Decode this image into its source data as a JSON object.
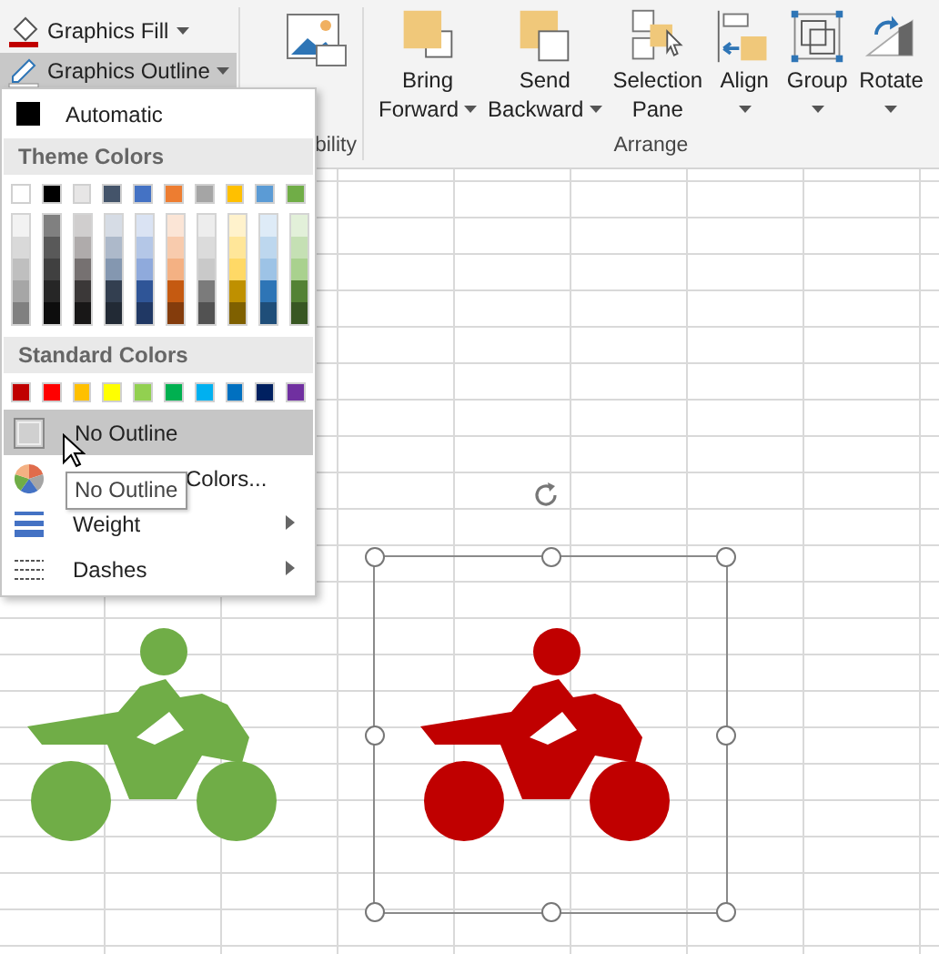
{
  "ribbon": {
    "fill_button": {
      "label": "Graphics Fill",
      "selected": false
    },
    "outline_button": {
      "label": "Graphics Outline",
      "selected": true
    },
    "accessibility_group": "bility",
    "arrange_buttons": [
      {
        "kind": "bring-forward",
        "lines": [
          "Bring",
          "Forward"
        ],
        "dropdown": true
      },
      {
        "kind": "send-backward",
        "lines": [
          "Send",
          "Backward"
        ],
        "dropdown": true
      },
      {
        "kind": "selection-pane",
        "lines": [
          "Selection",
          "Pane"
        ],
        "dropdown": false
      },
      {
        "kind": "align",
        "lines": [
          "Align"
        ],
        "dropdown": true
      },
      {
        "kind": "group",
        "lines": [
          "Group"
        ],
        "dropdown": true
      },
      {
        "kind": "rotate",
        "lines": [
          "Rotate"
        ],
        "dropdown": true
      }
    ],
    "arrange_group": "Arrange"
  },
  "menu": {
    "automatic": {
      "label": "Automatic",
      "color": "#000000"
    },
    "theme_header": "Theme Colors",
    "theme_colors": [
      {
        "color": "#ffffff",
        "shades": [
          {
            "color": "#f2f2f2"
          },
          {
            "color": "#d9d9d9"
          },
          {
            "color": "#bfbfbf"
          },
          {
            "color": "#a6a6a6"
          },
          {
            "color": "#808080"
          }
        ]
      },
      {
        "color": "#000000",
        "shades": [
          {
            "color": "#808080"
          },
          {
            "color": "#595959"
          },
          {
            "color": "#404040"
          },
          {
            "color": "#262626"
          },
          {
            "color": "#0d0d0d"
          }
        ]
      },
      {
        "color": "#e7e6e6",
        "shades": [
          {
            "color": "#d0cece"
          },
          {
            "color": "#afabab"
          },
          {
            "color": "#767171"
          },
          {
            "color": "#3b3838"
          },
          {
            "color": "#181717"
          }
        ]
      },
      {
        "color": "#44546a",
        "shades": [
          {
            "color": "#d6dce5"
          },
          {
            "color": "#adb9ca"
          },
          {
            "color": "#8497b0"
          },
          {
            "color": "#333f50"
          },
          {
            "color": "#222a35"
          }
        ]
      },
      {
        "color": "#4472c4",
        "shades": [
          {
            "color": "#dae3f3"
          },
          {
            "color": "#b4c7e7"
          },
          {
            "color": "#8faadc"
          },
          {
            "color": "#2f5597"
          },
          {
            "color": "#203864"
          }
        ]
      },
      {
        "color": "#ed7d31",
        "shades": [
          {
            "color": "#fbe5d6"
          },
          {
            "color": "#f8cbad"
          },
          {
            "color": "#f4b183"
          },
          {
            "color": "#c55a11"
          },
          {
            "color": "#843c0c"
          }
        ]
      },
      {
        "color": "#a5a5a5",
        "shades": [
          {
            "color": "#ededed"
          },
          {
            "color": "#dbdbdb"
          },
          {
            "color": "#c9c9c9"
          },
          {
            "color": "#7b7b7b"
          },
          {
            "color": "#525252"
          }
        ]
      },
      {
        "color": "#ffc000",
        "shades": [
          {
            "color": "#fff2cc"
          },
          {
            "color": "#ffe699"
          },
          {
            "color": "#ffd966"
          },
          {
            "color": "#bf9000"
          },
          {
            "color": "#7f6000"
          }
        ]
      },
      {
        "color": "#5b9bd5",
        "shades": [
          {
            "color": "#deebf7"
          },
          {
            "color": "#bdd7ee"
          },
          {
            "color": "#9dc3e6"
          },
          {
            "color": "#2e75b6"
          },
          {
            "color": "#1f4e79"
          }
        ]
      },
      {
        "color": "#70ad47",
        "shades": [
          {
            "color": "#e2f0d9"
          },
          {
            "color": "#c5e0b4"
          },
          {
            "color": "#a9d18e"
          },
          {
            "color": "#548235"
          },
          {
            "color": "#385723"
          }
        ]
      }
    ],
    "standard_header": "Standard Colors",
    "standard_colors": [
      {
        "color": "#c00000"
      },
      {
        "color": "#ff0000"
      },
      {
        "color": "#ffc000"
      },
      {
        "color": "#ffff00"
      },
      {
        "color": "#92d050"
      },
      {
        "color": "#00b050"
      },
      {
        "color": "#00b0f0"
      },
      {
        "color": "#0070c0"
      },
      {
        "color": "#002060"
      },
      {
        "color": "#7030a0"
      }
    ],
    "items": [
      {
        "kind": "no-outline",
        "label": "No Outline",
        "selected": true,
        "submenu": false
      },
      {
        "kind": "colors",
        "label": "Colors...",
        "selected": false,
        "submenu": false
      },
      {
        "kind": "weight",
        "label": "Weight",
        "selected": false,
        "submenu": true
      },
      {
        "kind": "dashes",
        "label": "Dashes",
        "selected": false,
        "submenu": true
      }
    ]
  },
  "tooltip": "No Outline",
  "graphics": [
    {
      "color": "#70ad47",
      "selected": false
    },
    {
      "color": "#c00000",
      "selected": true
    }
  ]
}
